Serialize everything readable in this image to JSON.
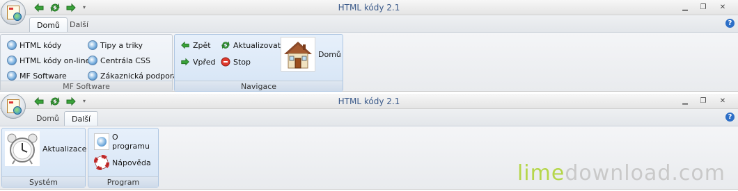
{
  "colors": {
    "title_text": "#3b5a8a",
    "group_blue": "#d5e4f5",
    "watermark_lime": "#b5d64a"
  },
  "window1": {
    "title": "HTML kódy 2.1",
    "tabs": [
      "Domů",
      "Další"
    ],
    "active_tab": "Domů",
    "groups": {
      "mf": {
        "label": "MF Software",
        "items": [
          "HTML kódy",
          "HTML kódy on-line",
          "MF Software",
          "Tipy a triky",
          "Centrála CSS",
          "Zákaznická podpora"
        ]
      },
      "nav": {
        "label": "Navigace",
        "back": "Zpět",
        "forward": "Vpřed",
        "refresh": "Aktualizovat",
        "stop": "Stop",
        "home": "Domů"
      }
    }
  },
  "window2": {
    "title": "HTML kódy 2.1",
    "tabs": [
      "Domů",
      "Další"
    ],
    "active_tab": "Další",
    "groups": {
      "system": {
        "label": "Systém",
        "update": "Aktualizace"
      },
      "program": {
        "label": "Program",
        "about": "O programu",
        "help": "Nápověda"
      }
    }
  },
  "watermark": {
    "lime": "lime",
    "rest": "download.com"
  }
}
